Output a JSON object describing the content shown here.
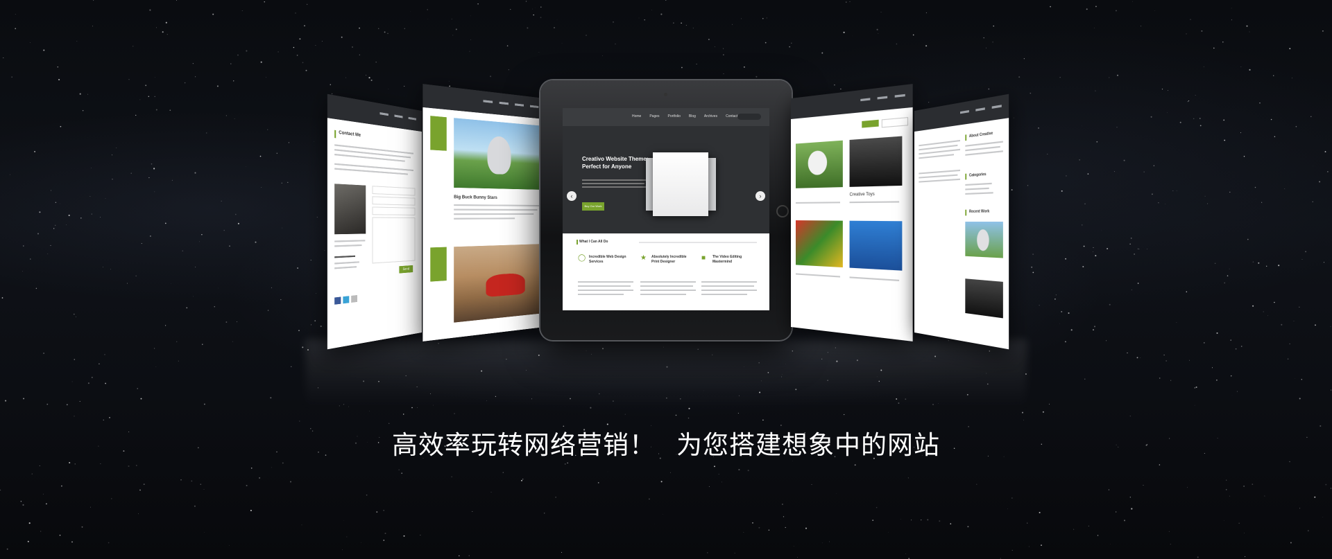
{
  "banner": {
    "caption_left": "高效率玩转网络营销！",
    "caption_right": "为您搭建想象中的网站"
  },
  "tablet": {
    "nav_items": [
      "Home",
      "Pages",
      "Portfolio",
      "Blog",
      "Archives",
      "Contact"
    ],
    "hero_title": "Creativo Website Theme: Perfect for Anyone",
    "hero_button": "Buy Our Work",
    "section_title": "What I Can All Do",
    "features": [
      "Incredible Web Design Services",
      "Absolutely Incredible Print Designer",
      "The Video Editing Mastermind"
    ]
  },
  "panel_left": {
    "contact_title": "Contact Me",
    "send_button": "Send"
  },
  "panel_blog": {
    "post_title": "Big Buck Bunny Stars"
  },
  "panel_portfolio": {
    "item_title": "Creative Toys"
  },
  "panel_right": {
    "about_title": "About Creative",
    "categories_title": "Categories",
    "recent_title": "Recent Work"
  },
  "colors": {
    "accent": "#79a32d",
    "background": "#0b0d12"
  }
}
